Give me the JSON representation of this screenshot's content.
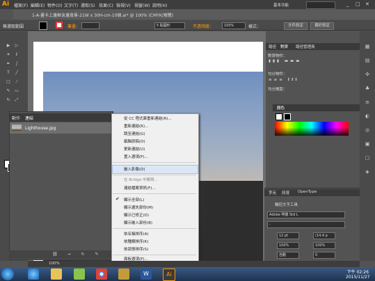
{
  "app": {
    "logo": "Ai",
    "workspace": "基本功能",
    "search_icon": "search-icon"
  },
  "menubar": {
    "items": [
      "檔案(F)",
      "編輯(E)",
      "物件(O)",
      "文字(T)",
      "選取(S)",
      "效果(C)",
      "檢視(V)",
      "視窗(W)",
      "說明(H)"
    ]
  },
  "control": {
    "selection_label": "無選取範圍",
    "stroke_label": "筆畫：",
    "stroke_value": "",
    "brush_value": "5 點圓形",
    "opacity_label": "不透明度：",
    "opacity_value": "100%",
    "style_label": "樣式：",
    "doc_setup": "文件設定",
    "prefs": "偏好設定"
  },
  "document": {
    "tab_title": "1-A-畫卡上邊框含邊背景-21W x 30H-cm-10個.ai* @ 100% (CMYK/預覽)"
  },
  "links_panel": {
    "tabs": [
      "動作",
      "連結"
    ],
    "items": [
      {
        "name": "Lighthouse.jpg"
      }
    ]
  },
  "context_menu": {
    "items": [
      {
        "label": "從 CC 程式庫重新連結(R)...",
        "disabled": false
      },
      {
        "label": "重新連結(R)...",
        "disabled": false
      },
      {
        "label": "跳至連結(G)",
        "disabled": false
      },
      {
        "label": "編輯原稿(O)",
        "disabled": false
      },
      {
        "label": "更新連結(U)",
        "disabled": false
      },
      {
        "label": "置入選項(P)...",
        "disabled": false
      },
      {
        "label": "嵌入影像(D)",
        "disabled": false,
        "highlighted": true
      },
      {
        "label": "在 Bridge 中顯現...",
        "disabled": true
      },
      {
        "label": "連結檔案資訊(F)...",
        "disabled": false
      },
      {
        "label": "顯示全部(L)",
        "disabled": false,
        "checked": true
      },
      {
        "label": "顯示遺失部份(M)",
        "disabled": false
      },
      {
        "label": "顯示已修正(D)",
        "disabled": false
      },
      {
        "label": "顯示嵌入部份(B)",
        "disabled": false
      },
      {
        "label": "依名稱排序(A)",
        "disabled": false
      },
      {
        "label": "依種類排序(K)",
        "disabled": false
      },
      {
        "label": "依狀態排序(S)",
        "disabled": false
      },
      {
        "label": "面板選項(P)...",
        "disabled": false
      }
    ]
  },
  "align_panel": {
    "tabs": [
      "路徑",
      "對齊",
      "路徑管理員"
    ],
    "align_objects": "對齊物件：",
    "distribute_objects": "均分物件：",
    "distribute_spacing": "均分間距："
  },
  "color_panel": {
    "tab": "顏色"
  },
  "character_panel": {
    "tabs": [
      "字元",
      "段落",
      "OpenType"
    ],
    "touch_type": "觸控文字工具",
    "font": "Adobe 明體 Std L",
    "font_style": "-",
    "size": "12 pt",
    "leading": "(14.4 p",
    "scale_v": "100%",
    "scale_h": "100%",
    "tracking": "自動",
    "kerning": "0"
  },
  "statusbar": {
    "zoom": "100%"
  },
  "taskbar": {
    "time": "下午 02:26",
    "date": "2015/11/27"
  }
}
